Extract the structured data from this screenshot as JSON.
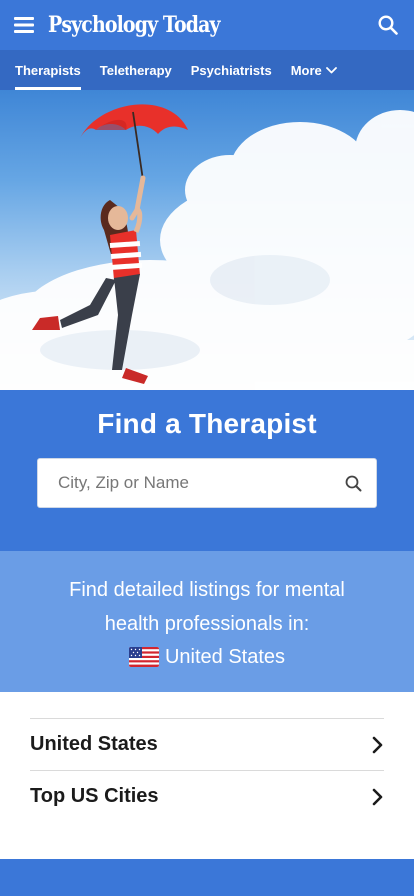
{
  "header": {
    "logo": "Psychology Today"
  },
  "nav": {
    "tabs": [
      {
        "label": "Therapists",
        "active": true
      },
      {
        "label": "Teletherapy",
        "active": false
      },
      {
        "label": "Psychiatrists",
        "active": false
      },
      {
        "label": "More",
        "active": false
      }
    ]
  },
  "find": {
    "title": "Find a Therapist",
    "placeholder": "City, Zip or Name"
  },
  "listing": {
    "line1": "Find detailed listings for mental",
    "line2": "health professionals in:",
    "country": "United States"
  },
  "links": [
    {
      "label": "United States"
    },
    {
      "label": "Top US Cities"
    }
  ],
  "colors": {
    "header": "#3b77d8",
    "nav": "#3469c2",
    "listing_band": "#6a9de6"
  },
  "icons": {
    "menu": "hamburger-icon",
    "search": "search-icon",
    "more": "chevron-down-icon",
    "row": "chevron-right-icon",
    "flag": "us-flag-icon"
  }
}
